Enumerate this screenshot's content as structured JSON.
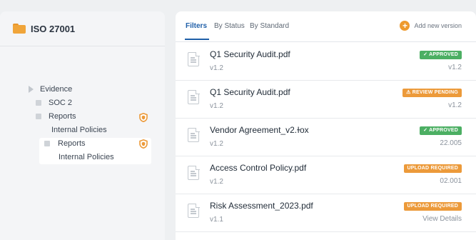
{
  "sidebar": {
    "title": "ISO 27001",
    "tree": [
      {
        "label": "Evidence"
      },
      {
        "label": "SOC 2"
      },
      {
        "label": "Reports",
        "shield": true
      },
      {
        "label": "Internal Policies"
      },
      {
        "label": "Reports",
        "shield": true,
        "selected": true
      },
      {
        "label": "Internal Policies"
      }
    ]
  },
  "tabs": [
    "Filters",
    "By Status",
    "By Standard"
  ],
  "active_tab": "Filters",
  "add_version_label": "Add new version",
  "files": [
    {
      "name": "Q1 Security Audit.pdf",
      "version": "v1.2",
      "status": "✓ APPROVED",
      "status_color": "#4caf63",
      "meta": "v1.2"
    },
    {
      "name": "Q1 Security Audit.pdf",
      "version": "v1.2",
      "status": "⚠ REVIEW PENDING",
      "status_color": "#ec9a3a",
      "meta": "v1.2"
    },
    {
      "name": "Vendor Agreement_v2.ɫox",
      "version": "v1.2",
      "status": "✓ APPROVED",
      "status_color": "#4caf63",
      "meta": "22.005"
    },
    {
      "name": "Access Control Policy.pdf",
      "version": "v1.2",
      "status": "UPLOAD REQUIRED",
      "status_color": "#ec9a3a",
      "meta": "02.001"
    },
    {
      "name": "Risk Assessment_2023.pdf",
      "version": "v1.1",
      "status": "UPLOAD REQUIRED",
      "status_color": "#ec9a3a",
      "meta": "View Details"
    }
  ]
}
